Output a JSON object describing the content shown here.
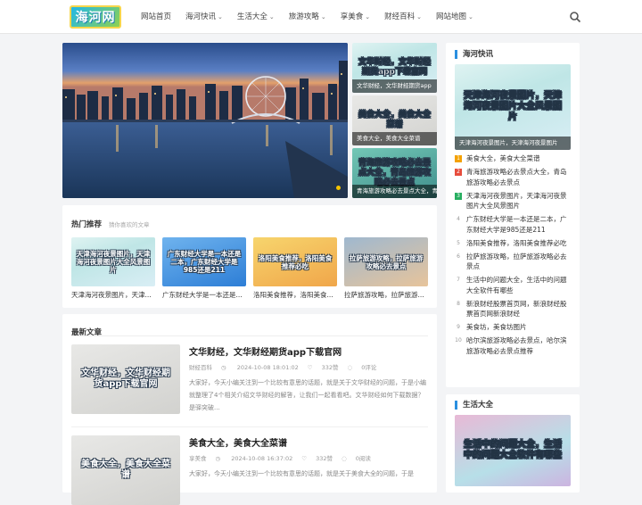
{
  "header": {
    "logo_text": "海河网",
    "nav": [
      {
        "label": "网站首页",
        "has_dropdown": false
      },
      {
        "label": "海河快讯",
        "has_dropdown": true
      },
      {
        "label": "生活大全",
        "has_dropdown": true
      },
      {
        "label": "旅游攻略",
        "has_dropdown": true
      },
      {
        "label": "享美食",
        "has_dropdown": true
      },
      {
        "label": "财经百科",
        "has_dropdown": true
      },
      {
        "label": "网站地图",
        "has_dropdown": true
      }
    ],
    "dropdown_glyph": "⌄",
    "search_icon": "search-icon"
  },
  "slider": {
    "thumbs": [
      {
        "image_text": "文华财经，文华财经期货app下载官网",
        "caption": "文华财经，文华财经期货app"
      },
      {
        "image_text": "美食大全，美食大全菜谱",
        "caption": "美食大全，美食大全菜谱"
      },
      {
        "image_text": "青海旅游攻略必去景点大全，青岛旅游攻略必去景点",
        "caption": "青海旅游攻略必去景点大全，青"
      }
    ]
  },
  "hot": {
    "title": "热门推荐",
    "subtitle": "猜你喜欢的文章",
    "items": [
      {
        "image_text": "天津海河夜景图片，天津海河夜景图片大全风景图片",
        "label": "天津海河夜景图片，天津..."
      },
      {
        "image_text": "广东财经大学是一本还是二本，广东财经大学是985还是211",
        "label": "广东财经大学是一本还是..."
      },
      {
        "image_text": "洛阳美食推荐，洛阳美食推荐必吃",
        "label": "洛阳美食推荐，洛阳美食..."
      },
      {
        "image_text": "拉萨旅游攻略，拉萨旅游攻略必去景点",
        "label": "拉萨旅游攻略，拉萨旅游..."
      }
    ]
  },
  "latest": {
    "title": "最新文章",
    "articles": [
      {
        "image_text": "文华财经，文华财经期货app下载官网",
        "title": "文华财经，文华财经期货app下载官网",
        "category": "财经百科",
        "date": "2024-10-08 18:01:02",
        "likes": "332赞",
        "comments": "0评论",
        "excerpt": "大家好，今天小编关注到一个比较有意思的话题，就是关于文华财经的问题，于是小编就整理了4个相关介绍文华财经的解答，让我们一起看看吧。文华财经如何下载数据？ 是驿突破..."
      },
      {
        "image_text": "美食大全，美食大全菜谱",
        "title": "美食大全，美食大全菜谱",
        "category": "享美食",
        "date": "2024-10-08 16:37:02",
        "likes": "332赞",
        "comments": "0阅读",
        "excerpt": "大家好，今天小编关注到一个比较有意思的话题，就是关于美食大全的问题，于是"
      }
    ]
  },
  "sidebar": {
    "news": {
      "title": "海河快讯",
      "image_text": "天津海河夜景图片，天津海河夜景图片大全风景图片",
      "caption": "天津海河夜景图片，天津海河夜景图片",
      "items": [
        {
          "num": "1",
          "text": "美食大全，美食大全菜谱"
        },
        {
          "num": "2",
          "text": "青海旅游攻略必去景点大全，青岛旅游攻略必去景点"
        },
        {
          "num": "3",
          "text": "天津海河夜景图片，天津海河夜景图片大全风景图片"
        },
        {
          "num": "4",
          "text": "广东财经大学是一本还是二本，广东财经大学是985还是211"
        },
        {
          "num": "5",
          "text": "洛阳美食推荐，洛阳美食推荐必吃"
        },
        {
          "num": "6",
          "text": "拉萨旅游攻略，拉萨旅游攻略必去景点"
        },
        {
          "num": "7",
          "text": "生活中的问题大全，生活中的问题大全软件有哪些"
        },
        {
          "num": "8",
          "text": "新浪财经股票首页网，新浪财经股票首页网新浪财经"
        },
        {
          "num": "9",
          "text": "美食坊，美食坊图片"
        },
        {
          "num": "10",
          "text": "哈尔滨旅游攻略必去景点，哈尔滨旅游攻略必去景点推荐"
        }
      ]
    },
    "life": {
      "title": "生活大全",
      "image_text": "生活中的问题大全，生活中的问题大全软件有哪些"
    }
  },
  "colors": {
    "accent": "#2a8fe0",
    "rank1": "#f4a100",
    "rank2": "#e74c3c",
    "rank3": "#27ae60"
  }
}
